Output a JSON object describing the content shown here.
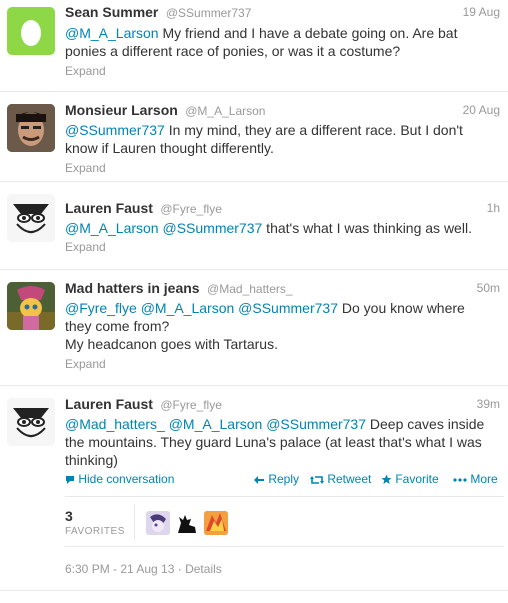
{
  "tweets": [
    {
      "name": "Sean Summer",
      "handle": "@SSummer737",
      "time": "19 Aug",
      "text_parts": [
        {
          "t": "@M_A_Larson",
          "m": true
        },
        {
          "t": " My friend and I have a debate going on.  Are bat ponies a different race of ponies, or was it a costume?",
          "m": false
        }
      ],
      "expand": "Expand"
    },
    {
      "name": "Monsieur Larson",
      "handle": "@M_A_Larson",
      "time": "20 Aug",
      "text_parts": [
        {
          "t": "@SSummer737",
          "m": true
        },
        {
          "t": " In my mind, they are a different race.  But I don't know if Lauren thought differently.",
          "m": false
        }
      ],
      "expand": "Expand"
    },
    {
      "name": "Lauren Faust",
      "handle": "@Fyre_flye",
      "time": "1h",
      "text_parts": [
        {
          "t": "@M_A_Larson",
          "m": true
        },
        {
          "t": " ",
          "m": false
        },
        {
          "t": "@SSummer737",
          "m": true
        },
        {
          "t": " that's what I was thinking as well.",
          "m": false
        }
      ],
      "expand": "Expand"
    },
    {
      "name": "Mad hatters in jeans",
      "handle": "@Mad_hatters_",
      "time": "50m",
      "text_parts": [
        {
          "t": "@Fyre_flye",
          "m": true
        },
        {
          "t": " ",
          "m": false
        },
        {
          "t": "@M_A_Larson",
          "m": true
        },
        {
          "t": " ",
          "m": false
        },
        {
          "t": "@SSummer737",
          "m": true
        },
        {
          "t": " Do you know where they come from?",
          "m": false
        },
        {
          "t": "\nMy headcanon goes with Tartarus.",
          "m": false
        }
      ],
      "expand": "Expand"
    },
    {
      "name": "Lauren Faust",
      "handle": "@Fyre_flye",
      "time": "39m",
      "text_parts": [
        {
          "t": "@Mad_hatters_",
          "m": true
        },
        {
          "t": " ",
          "m": false
        },
        {
          "t": "@M_A_Larson",
          "m": true
        },
        {
          "t": " ",
          "m": false
        },
        {
          "t": "@SSummer737",
          "m": true
        },
        {
          "t": " Deep caves inside the mountains. They guard Luna's palace (at least that's what I was thinking)",
          "m": false
        }
      ]
    }
  ],
  "actions": {
    "hide_conversation": "Hide conversation",
    "reply": "Reply",
    "retweet": "Retweet",
    "favorite": "Favorite",
    "more": "More"
  },
  "stats": {
    "favorites_count": "3",
    "favorites_label": "FAVORITES"
  },
  "meta": {
    "timestamp": "6:30 PM - 21 Aug 13",
    "separator": "·",
    "details": "Details"
  },
  "colors": {
    "link": "#0084b4",
    "muted": "#999999",
    "text": "#333333",
    "egg_bg": "#8ed847"
  }
}
